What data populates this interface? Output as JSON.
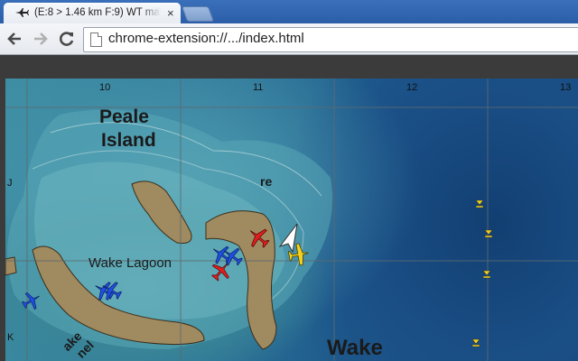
{
  "browser": {
    "tab_title": "(E:8 > 1.46 km F:9) WT ma",
    "close_glyph": "×",
    "url": "chrome-extension://.../index.html"
  },
  "map": {
    "col_labels": [
      "10",
      "11",
      "12",
      "13"
    ],
    "row_labels": [
      "J",
      "K"
    ],
    "place_names": {
      "peale_line1": "Peale",
      "peale_line2": "Island",
      "lagoon": "Wake Lagoon",
      "wake": "Wake",
      "reef": "re",
      "lower_left_1": "ake",
      "lower_left_2": "nel"
    },
    "units": [
      {
        "type": "fighter",
        "side": "allied",
        "color": "#1f4fe0"
      },
      {
        "type": "fighter",
        "side": "allied",
        "color": "#1f4fe0"
      },
      {
        "type": "fighter",
        "side": "allied",
        "color": "#1f4fe0"
      },
      {
        "type": "fighter",
        "side": "allied",
        "color": "#1f4fe0"
      },
      {
        "type": "fighter",
        "side": "allied",
        "color": "#1f4fe0"
      },
      {
        "type": "fighter",
        "side": "enemy",
        "color": "#e01e1e"
      },
      {
        "type": "fighter",
        "side": "enemy",
        "color": "#e01e1e"
      },
      {
        "type": "bomber",
        "side": "player",
        "color": "#f2d21c"
      },
      {
        "type": "ground-target",
        "color": "#f2d21c"
      },
      {
        "type": "ground-target",
        "color": "#f2d21c"
      },
      {
        "type": "ground-target",
        "color": "#f2d21c"
      },
      {
        "type": "ground-target",
        "color": "#f2d21c"
      },
      {
        "type": "player-arrow",
        "color": "#ffffff"
      }
    ]
  }
}
